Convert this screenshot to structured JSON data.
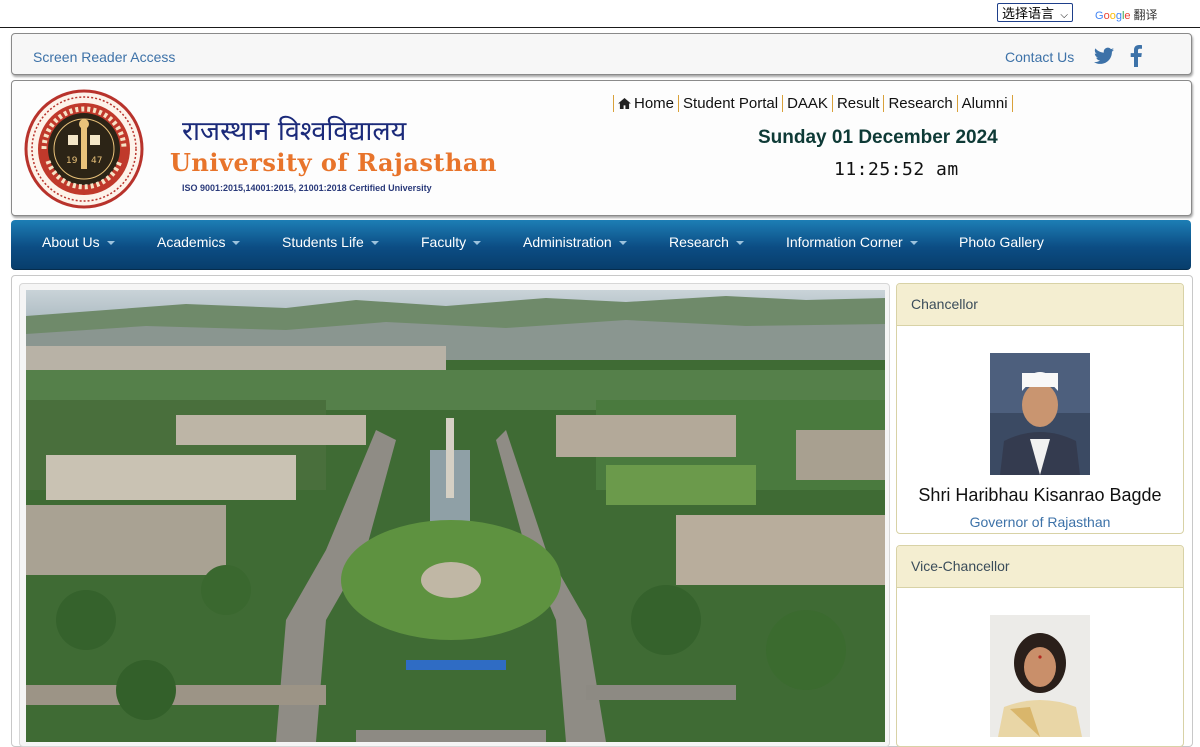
{
  "translate": {
    "select_label": "选择语言",
    "brand_g": "G",
    "brand_o1": "o",
    "brand_o2": "o",
    "brand_g2": "g",
    "brand_l": "l",
    "brand_e": "e",
    "translate_label": "翻译"
  },
  "utility": {
    "screen_reader": "Screen Reader Access",
    "contact": "Contact Us"
  },
  "header": {
    "hindi_name": "राजस्थान विश्वविद्यालय",
    "english_name": "University of Rajasthan",
    "iso_text": "ISO 9001:2015,14001:2015, 21001:2018 Certified University",
    "quick_links": [
      "Home",
      "Student Portal",
      "DAAK",
      "Result",
      "Research",
      "Alumni"
    ],
    "date": "Sunday 01 December 2024",
    "time": "11:25:52 am"
  },
  "nav": {
    "items": [
      "About Us",
      "Academics",
      "Students Life",
      "Faculty",
      "Administration",
      "Research",
      "Information Corner",
      "Photo Gallery"
    ]
  },
  "sidebar": {
    "chancellor": {
      "heading": "Chancellor",
      "name": "Shri Haribhau Kisanrao Bagde",
      "title": "Governor of Rajasthan"
    },
    "vice_chancellor": {
      "heading": "Vice-Chancellor"
    }
  },
  "colors": {
    "nav_top": "#1d7eb5",
    "nav_bottom": "#083e6c",
    "brand_orange": "#e8742b",
    "link_blue": "#3d72a8",
    "card_header": "#f4eed1"
  }
}
